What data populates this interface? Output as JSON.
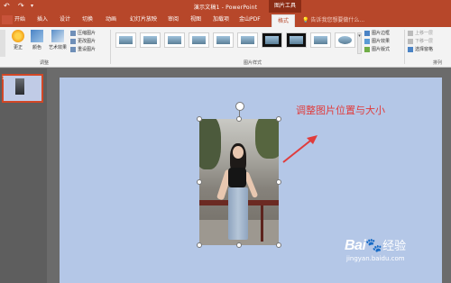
{
  "titlebar": {
    "doc_title": "演示文稿1 - PowerPoint",
    "context_tools": "图片工具",
    "undo_icon": "undo-icon",
    "redo_icon": "redo-icon",
    "customize_icon": "customize-quick-access-icon"
  },
  "tabs": [
    "开始",
    "插入",
    "设计",
    "切换",
    "动画",
    "幻灯片放映",
    "审阅",
    "视图",
    "加载项",
    "金山PDF",
    "格式"
  ],
  "active_tab": "格式",
  "tell_me_placeholder": "告诉我您想要做什么...",
  "ribbon": {
    "adjust_group": {
      "label": "调整",
      "corrections": "更正",
      "color": "颜色",
      "artistic": "艺术效果",
      "compress": "压缩图片",
      "change": "更改图片",
      "reset": "重设图片"
    },
    "styles_group": {
      "label": "图片样式",
      "border": "图片边框",
      "effects": "图片效果",
      "layout": "图片版式"
    },
    "arrange_group": {
      "label": "排列",
      "bring_forward": "上移一层",
      "send_backward": "下移一层",
      "selection_pane": "选择窗格"
    }
  },
  "slide_panel": {
    "slide_number": "1"
  },
  "slide": {
    "annotation_text": "调整图片位置与大小"
  },
  "watermark": {
    "brand": "Bai",
    "brand_suffix": "经验",
    "url": "jingyan.baidu.com"
  },
  "colors": {
    "accent": "#b7472a",
    "slide_bg": "#b4c7e7",
    "annotation": "#e03c3c"
  }
}
